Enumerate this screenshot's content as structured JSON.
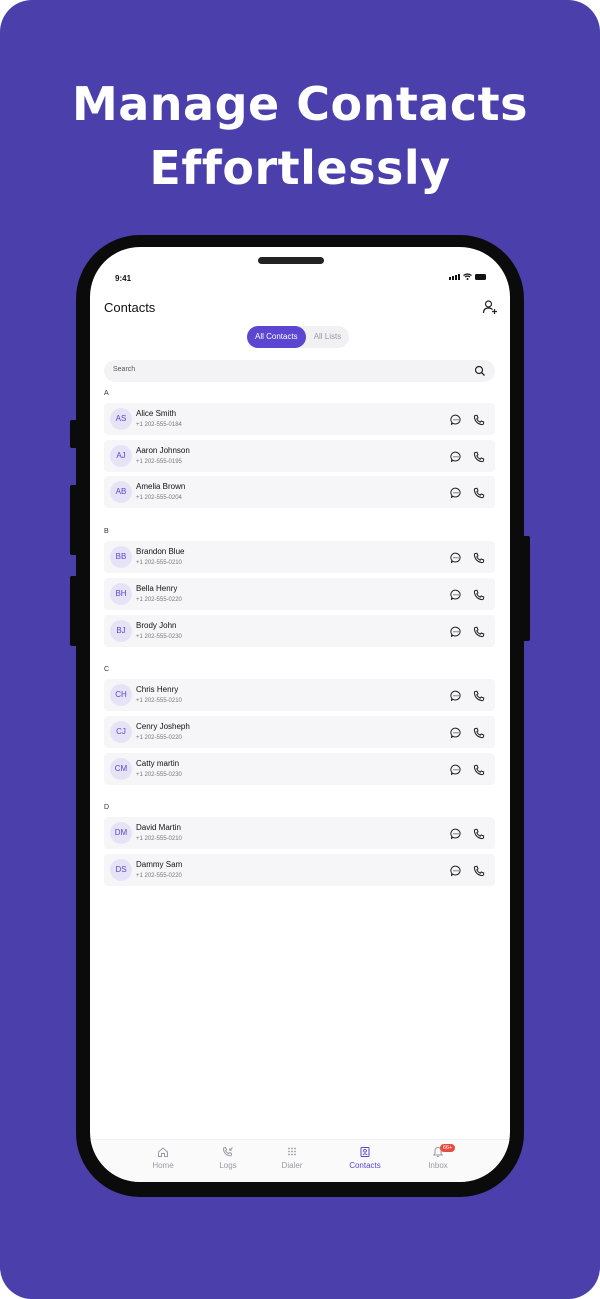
{
  "headline": {
    "line1": "Manage Contacts",
    "line2": "Effortlessly"
  },
  "status": {
    "time": "9:41"
  },
  "header": {
    "title": "Contacts",
    "add_icon": "add-user-icon"
  },
  "segmented": {
    "all_contacts": "All Contacts",
    "all_lists": "All Lists",
    "selected": "All Contacts"
  },
  "search": {
    "placeholder": "Search"
  },
  "sections": [
    {
      "letter": "A",
      "contacts": [
        {
          "initials": "AS",
          "name": "Alice Smith",
          "phone": "+1 202-555-0184"
        },
        {
          "initials": "AJ",
          "name": "Aaron Johnson",
          "phone": "+1 202-555-0195"
        },
        {
          "initials": "AB",
          "name": "Amelia Brown",
          "phone": "+1 202-555-0204"
        }
      ]
    },
    {
      "letter": "B",
      "contacts": [
        {
          "initials": "BB",
          "name": "Brandon Blue",
          "phone": "+1 202-555-0210"
        },
        {
          "initials": "BH",
          "name": "Bella Henry",
          "phone": "+1 202-555-0220"
        },
        {
          "initials": "BJ",
          "name": "Brody John",
          "phone": "+1 202-555-0230"
        }
      ]
    },
    {
      "letter": "C",
      "contacts": [
        {
          "initials": "CH",
          "name": "Chris Henry",
          "phone": "+1 202-555-0210"
        },
        {
          "initials": "CJ",
          "name": "Cenry Josheph",
          "phone": "+1 202-555-0220"
        },
        {
          "initials": "CM",
          "name": "Catty martin",
          "phone": "+1 202-555-0230"
        }
      ]
    },
    {
      "letter": "D",
      "contacts": [
        {
          "initials": "DM",
          "name": "David Martin",
          "phone": "+1 202-555-0210"
        },
        {
          "initials": "DS",
          "name": "Dammy Sam",
          "phone": "+1 202-555-0220"
        }
      ]
    }
  ],
  "tabs": [
    {
      "label": "Home",
      "icon": "home-icon"
    },
    {
      "label": "Logs",
      "icon": "call-log-icon"
    },
    {
      "label": "Dialer",
      "icon": "dialpad-icon"
    },
    {
      "label": "Contacts",
      "icon": "contacts-icon",
      "active": true
    },
    {
      "label": "Inbox",
      "icon": "inbox-icon",
      "badge": "66+"
    }
  ],
  "colors": {
    "background": "#4a3fab",
    "accent": "#5a46d0",
    "badge": "#e74c3c"
  }
}
